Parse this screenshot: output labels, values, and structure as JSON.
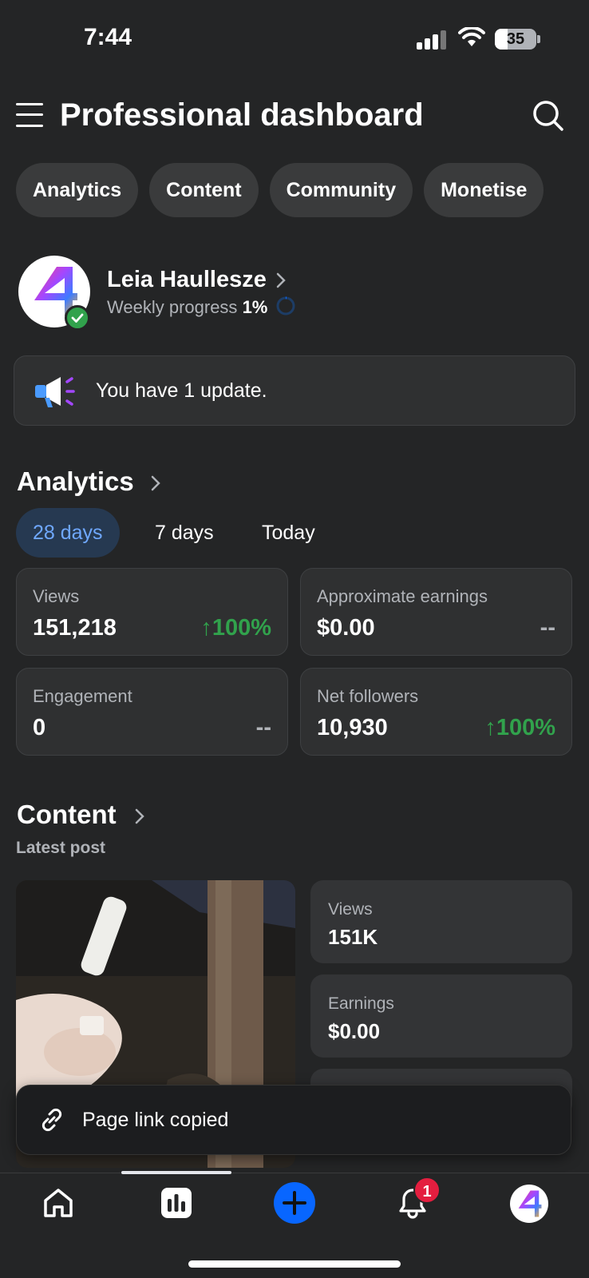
{
  "status_bar": {
    "time": "7:44",
    "battery": "35"
  },
  "header": {
    "title": "Professional dashboard"
  },
  "chips": [
    "Analytics",
    "Content",
    "Community",
    "Monetise"
  ],
  "profile": {
    "name": "Leia Haullesze",
    "progress_label": "Weekly progress",
    "progress_value": "1%"
  },
  "update": {
    "text": "You have 1 update."
  },
  "analytics": {
    "title": "Analytics",
    "ranges": [
      "28 days",
      "7 days",
      "Today"
    ],
    "active_range": "28 days",
    "cards": [
      {
        "label": "Views",
        "value": "151,218",
        "change": "↑100%"
      },
      {
        "label": "Approximate earnings",
        "value": "$0.00",
        "change": "--"
      },
      {
        "label": "Engagement",
        "value": "0",
        "change": "--"
      },
      {
        "label": "Net followers",
        "value": "10,930",
        "change": "↑100%"
      }
    ]
  },
  "content": {
    "title": "Content",
    "subtitle": "Latest post",
    "post_stats": [
      {
        "label": "Views",
        "value": "151K"
      },
      {
        "label": "Earnings",
        "value": "$0.00"
      }
    ]
  },
  "toast": {
    "text": "Page link copied"
  },
  "bottom_nav": {
    "items": [
      "home-icon",
      "insights-icon",
      "create-icon",
      "notifications-icon",
      "profile-avatar"
    ],
    "notification_count": "1"
  },
  "colors": {
    "background": "#242526",
    "card": "#2f3031",
    "accent_blue": "#0866ff",
    "positive_green": "#31a24c",
    "badge_red": "#e41e3f"
  }
}
